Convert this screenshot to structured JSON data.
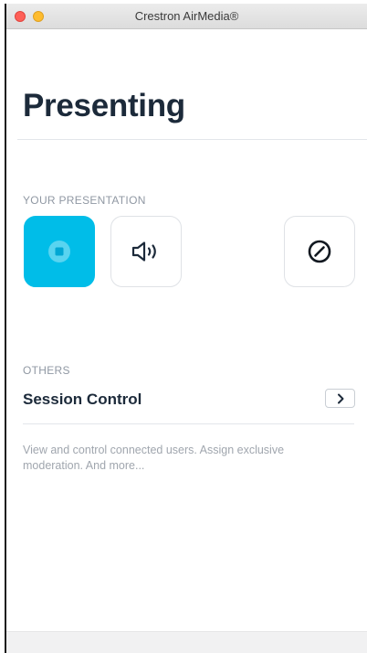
{
  "window": {
    "title": "Crestron AirMedia®"
  },
  "page": {
    "title": "Presenting"
  },
  "presentation": {
    "section_label": "YOUR PRESENTATION",
    "controls": [
      {
        "name": "stop-presenting-button",
        "icon": "stop-icon",
        "active": true,
        "color": "#00bde8"
      },
      {
        "name": "audio-button",
        "icon": "speaker-icon",
        "active": false
      },
      {
        "name": "disconnect-button",
        "icon": "prohibited-icon",
        "active": false
      }
    ]
  },
  "others": {
    "section_label": "OTHERS",
    "session_control": {
      "title": "Session Control",
      "description": "View and control connected users. Assign exclusive moderation. And more..."
    }
  },
  "colors": {
    "accent": "#00bde8",
    "heading": "#1c2a3a",
    "muted": "#9098a3"
  }
}
